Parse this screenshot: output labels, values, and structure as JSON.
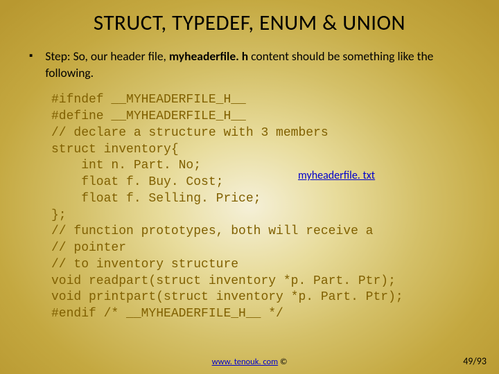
{
  "title": "STRUCT, TYPEDEF, ENUM & UNION",
  "step": {
    "prefix": "Step: So, our header file, ",
    "filename": "myheaderfile. h",
    "suffix": " content should be something like the following."
  },
  "code": "#ifndef __MYHEADERFILE_H__\n#define __MYHEADERFILE_H__\n// declare a structure with 3 members\nstruct inventory{\n    int n. Part. No;\n    float f. Buy. Cost;\n    float f. Selling. Price;\n};\n// function prototypes, both will receive a\n// pointer\n// to inventory structure\nvoid readpart(struct inventory *p. Part. Ptr);\nvoid printpart(struct inventory *p. Part. Ptr);\n#endif /* __MYHEADERFILE_H__ */",
  "link_label": "myheaderfile. txt",
  "footer": {
    "url": "www. tenouk. com",
    "copyright": " ©"
  },
  "page": "49/93"
}
